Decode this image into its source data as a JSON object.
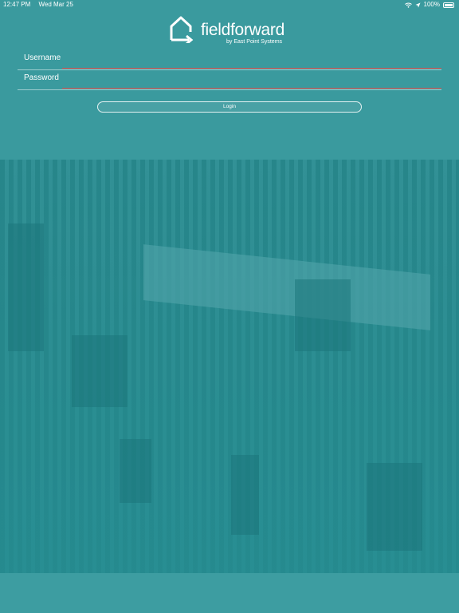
{
  "status_bar": {
    "time": "12:47 PM",
    "date": "Wed Mar 25",
    "battery": "100%",
    "icons": [
      "wifi-icon",
      "location-arrow-icon",
      "battery-icon"
    ]
  },
  "logo": {
    "wordmark": "fieldforward",
    "tagline": "by East Point Systems",
    "icon": "house-arrow-icon"
  },
  "form": {
    "username_label": "Username",
    "username_value": "",
    "password_label": "Password",
    "password_value": "",
    "login_label": "Login"
  },
  "colors": {
    "background": "#3a9a9e",
    "input_underline": "#d9534f",
    "text": "#ffffff"
  }
}
